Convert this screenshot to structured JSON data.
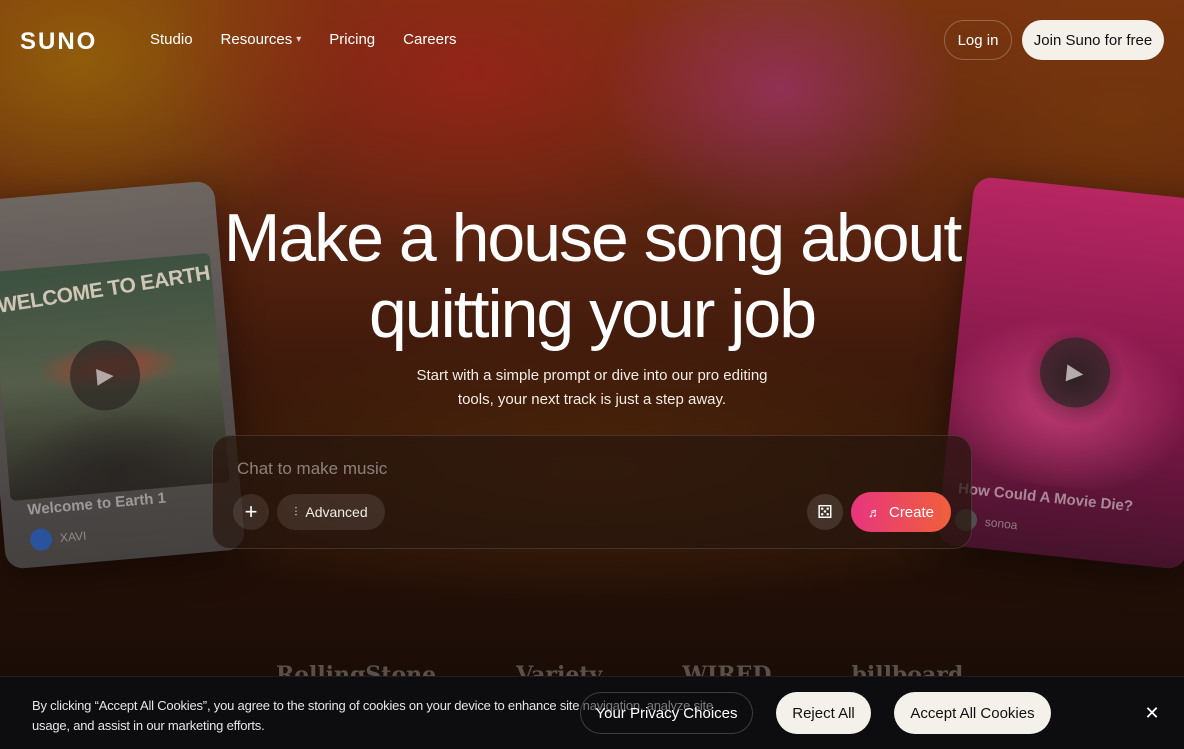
{
  "nav": {
    "logo": "SUNO",
    "links": [
      "Studio",
      "Resources",
      "Pricing",
      "Careers"
    ],
    "resources_chevron": "⌄",
    "login": "Log in",
    "join": "Join Suno for free"
  },
  "cards": {
    "left": {
      "art_text": "WELCOME TO EARTH",
      "title": "Welcome to Earth 1",
      "artist": "XAVI",
      "play_icon": "play-icon"
    },
    "right": {
      "title": "How Could A Movie Die?",
      "artist": "sonoa",
      "play_icon": "play-icon"
    }
  },
  "hero": {
    "title_line1": "Make a house song about",
    "title_line2": "quitting your job",
    "subtitle_line1": "Start with a simple prompt or dive into our pro editing",
    "subtitle_line2": "tools, your next track is just a step away."
  },
  "prompt": {
    "placeholder": "Chat to make music",
    "value": "",
    "advanced": "Advanced",
    "create": "Create",
    "icons": [
      "plus-icon",
      "sliders-icon",
      "dice-icon",
      "music-note-icon"
    ]
  },
  "press": [
    "RollingStone",
    "Variety",
    "WIRED",
    "billboard"
  ],
  "cookie": {
    "text": "By clicking “Accept All Cookies”, you agree to the storing of cookies on your device to enhance site navigation, analyze site usage, and assist in our marketing efforts.",
    "privacy": "Your Privacy Choices",
    "reject": "Reject All",
    "accept": "Accept All Cookies",
    "close_icon": "close-icon"
  },
  "colors": {
    "create_gradient_start": "#e8357f",
    "create_gradient_end": "#f0603a",
    "light_button": "#f4f1ea",
    "cookie_bg": "#0d0d0f"
  }
}
